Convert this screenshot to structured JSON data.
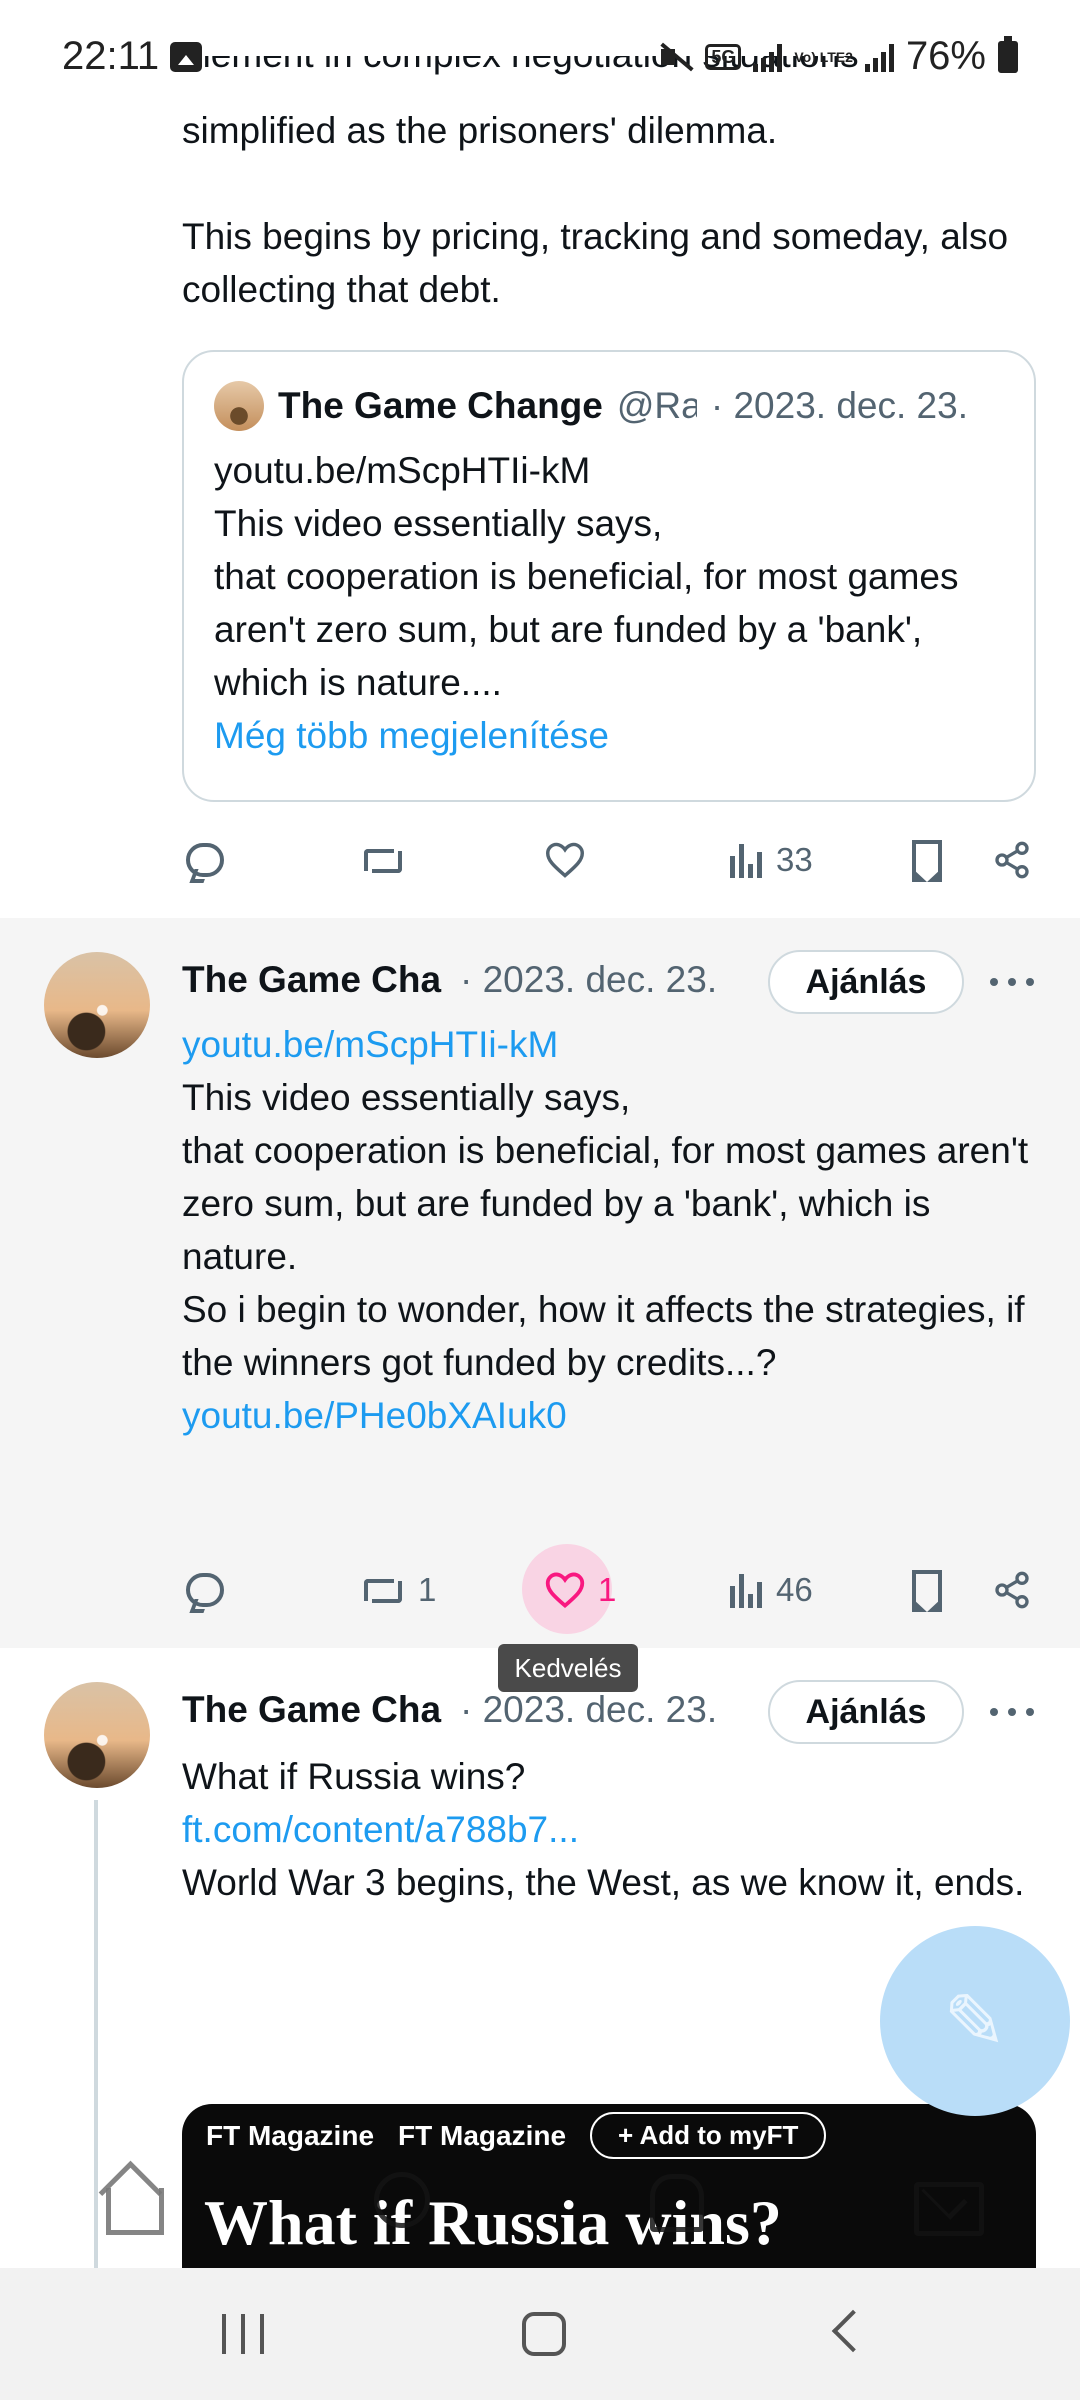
{
  "status_bar": {
    "time": "22:11",
    "network_badge": "5G",
    "volte": "Vo) LTE2",
    "battery": "76%"
  },
  "tweet1": {
    "text": "simplified as the prisoners' dilemma.\n\nThis begins by pricing, tracking and someday, also collecting that debt.",
    "cut_line": "element in complex negotiation situations",
    "quote": {
      "name": "The Game Change",
      "handle": "@Ra",
      "date": "· 2023. dec. 23.",
      "link": "youtu.be/mScpHTIi-kM",
      "text": "This video essentially says,\nthat cooperation is beneficial, for most games aren't zero sum, but are funded by a 'bank', which is nature....",
      "show_more": "Még több megjelenítése"
    },
    "actions": {
      "views": "33"
    }
  },
  "tweet2": {
    "name": "The Game Cha",
    "date": "· 2023. dec. 23.",
    "recommend": "Ajánlás",
    "link1": "youtu.be/mScpHTIi-kM",
    "text": "This video essentially says,\nthat cooperation is beneficial, for most games aren't zero sum, but are funded by a 'bank', which is nature.\nSo i begin to wonder, how it affects the strategies, if the winners got funded by credits...?",
    "link2": "youtu.be/PHe0bXAIuk0",
    "actions": {
      "retweets": "1",
      "likes": "1",
      "views": "46"
    },
    "tooltip": "Kedvelés"
  },
  "tweet3": {
    "name": "The Game Cha",
    "date": "· 2023. dec. 23.",
    "recommend": "Ajánlás",
    "text1": "What if Russia wins?",
    "link": "ft.com/content/a788b7...",
    "text2": "World War 3 begins, the West, as we know it, ends.",
    "card": {
      "label1": "FT Magazine",
      "label2": "FT Magazine",
      "button": "+ Add to myFT",
      "title": "What if Russia wins?"
    }
  },
  "colors": {
    "accent": "#1d9bf0",
    "like": "#f91880",
    "muted": "#536471"
  }
}
